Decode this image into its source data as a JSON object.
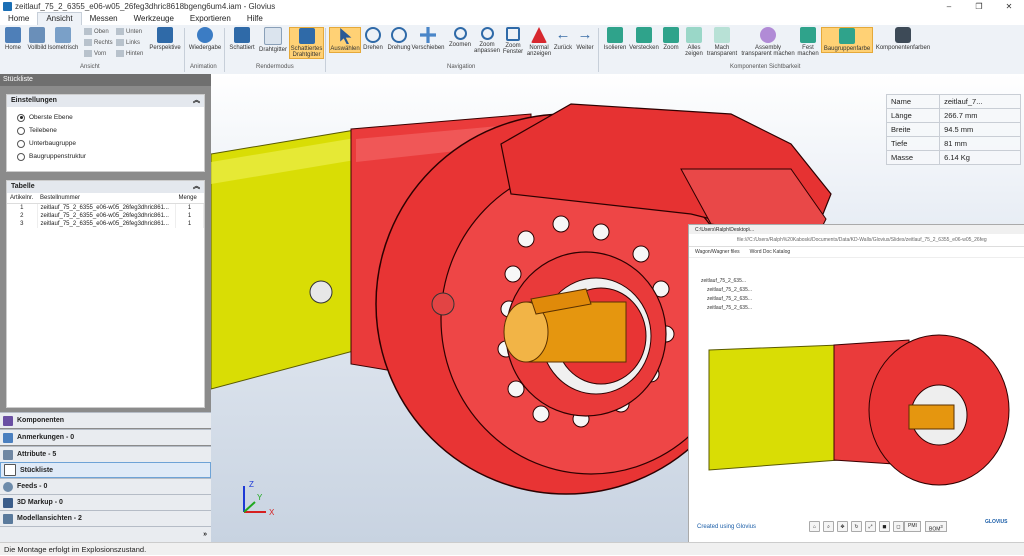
{
  "window": {
    "title": "zeitlauf_75_2_6355_e06-w05_26feg3dhric8618bgeng6um4.iam - Glovius",
    "controls": [
      "–",
      "❐",
      "✕"
    ]
  },
  "menu": [
    "Home",
    "Ansicht",
    "Messen",
    "Werkzeuge",
    "Exportieren",
    "Hilfe"
  ],
  "ribbon": {
    "buttons": [
      "Home",
      "Vollbild",
      "Isometrisch",
      "Perspektive",
      "Wiedergabe",
      "Schattiert",
      "Drahtgitter",
      "Schattiertes Drahtgitter",
      "Auswählen",
      "Drehen",
      "Drehung",
      "Verschieben",
      "Zoomen",
      "Zoom anpassen",
      "Zoom Fenster",
      "Normal anzeigen",
      "Zurück",
      "Weiter",
      "Isolieren",
      "Verstecken",
      "Zoom",
      "Alles zeigen",
      "Mach transparent",
      "Assembly transparent machen",
      "Fest machen",
      "Baugruppenfarbe",
      "Komponentenfarben"
    ],
    "small": [
      "Oben",
      "Rechts",
      "Vorn",
      "Unten",
      "Links",
      "Hinten"
    ],
    "groups": [
      "Ansicht",
      "Animation",
      "Rendermodus",
      "Navigation",
      "Komponenten Sichtbarkeit"
    ]
  },
  "panel": {
    "header": "Stückliste",
    "settings": {
      "title": "Einstellungen",
      "options": [
        "Oberste Ebene",
        "Teilebene",
        "Unterbaugruppe",
        "Baugruppenstruktur"
      ],
      "selected": 0
    },
    "table": {
      "title": "Tabelle",
      "columns": [
        "Artikelnr.",
        "Bestellnummer",
        "Menge"
      ],
      "rows": [
        [
          "1",
          "zeitlauf_75_2_6355_e06-w05_26feg3dhric861...",
          "1"
        ],
        [
          "2",
          "zeitlauf_75_2_6355_e06-w05_26feg3dhric861...",
          "1"
        ],
        [
          "3",
          "zeitlauf_75_2_6355_e06-w05_26feg3dhric861...",
          "1"
        ]
      ]
    },
    "accordion": [
      "Komponenten",
      "Anmerkungen - 0",
      "Attribute - 5",
      "Stückliste",
      "Feeds - 0",
      "3D Markup - 0",
      "Modellansichten - 2"
    ]
  },
  "properties": [
    [
      "Name",
      "zeitlauf_7..."
    ],
    [
      "Länge",
      "266.7 mm"
    ],
    [
      "Breite",
      "94.5 mm"
    ],
    [
      "Tiefe",
      "81 mm"
    ],
    [
      "Masse",
      "6.14 Kg"
    ]
  ],
  "inset": {
    "tab": "C:\\Users\\Ralph\\Desktop\\...",
    "address": "file:///C:/Users/Ralph%20Kaboski/Documents/Data/KD-Walls/Glovius/Slides/zeitlauf_75_2_6355_e06-w05_26feg",
    "bookmarks": [
      "Wagon/Wagner files",
      "Word Doc Katalog"
    ],
    "tree": [
      "zeitlauf_75_2_635...",
      "zeitlauf_75_2_635...",
      "zeitlauf_75_2_635...",
      "zeitlauf_75_2_635..."
    ],
    "credit": "Created using Glovius",
    "pmi": "PMI",
    "bom": "BOM",
    "bom_badge": "3",
    "logo": "GLOVIUS"
  },
  "axes": {
    "x": "X",
    "y": "Y",
    "z": "Z"
  },
  "status": "Die Montage erfolgt im Explosionszustand."
}
